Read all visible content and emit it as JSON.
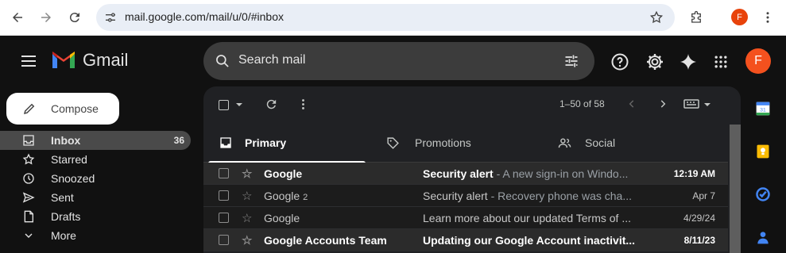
{
  "browser": {
    "url": "mail.google.com/mail/u/0/#inbox",
    "profile_initial": "F"
  },
  "app": {
    "name": "Gmail",
    "search_placeholder": "Search mail",
    "avatar_initial": "F"
  },
  "sidebar": {
    "compose_label": "Compose",
    "items": [
      {
        "label": "Inbox",
        "count": "36",
        "icon": "inbox-icon"
      },
      {
        "label": "Starred",
        "count": "",
        "icon": "star-icon"
      },
      {
        "label": "Snoozed",
        "count": "",
        "icon": "clock-icon"
      },
      {
        "label": "Sent",
        "count": "",
        "icon": "send-icon"
      },
      {
        "label": "Drafts",
        "count": "",
        "icon": "draft-icon"
      },
      {
        "label": "More",
        "count": "",
        "icon": "chevron-down-icon"
      }
    ]
  },
  "toolbar": {
    "pagination": "1–50 of 58"
  },
  "tabs": [
    {
      "label": "Primary"
    },
    {
      "label": "Promotions"
    },
    {
      "label": "Social"
    }
  ],
  "emails": [
    {
      "sender": "Google",
      "thread_count": "",
      "subject": "Security alert",
      "snippet": " - A new sign-in on Windo...",
      "date": "12:19 AM",
      "unread": true
    },
    {
      "sender": "Google",
      "thread_count": "2",
      "subject": "Security alert",
      "snippet": " - Recovery phone was cha...",
      "date": "Apr 7",
      "unread": false
    },
    {
      "sender": "Google",
      "thread_count": "",
      "subject": "Learn more about our updated Terms of ...",
      "snippet": "",
      "date": "4/29/24",
      "unread": false
    },
    {
      "sender": "Google Accounts Team",
      "thread_count": "",
      "subject": "Updating our Google Account inactivit...",
      "snippet": "",
      "date": "8/11/23",
      "unread": true
    }
  ],
  "colors": {
    "accent": "#f4511e",
    "panel_bg": "#202124"
  }
}
